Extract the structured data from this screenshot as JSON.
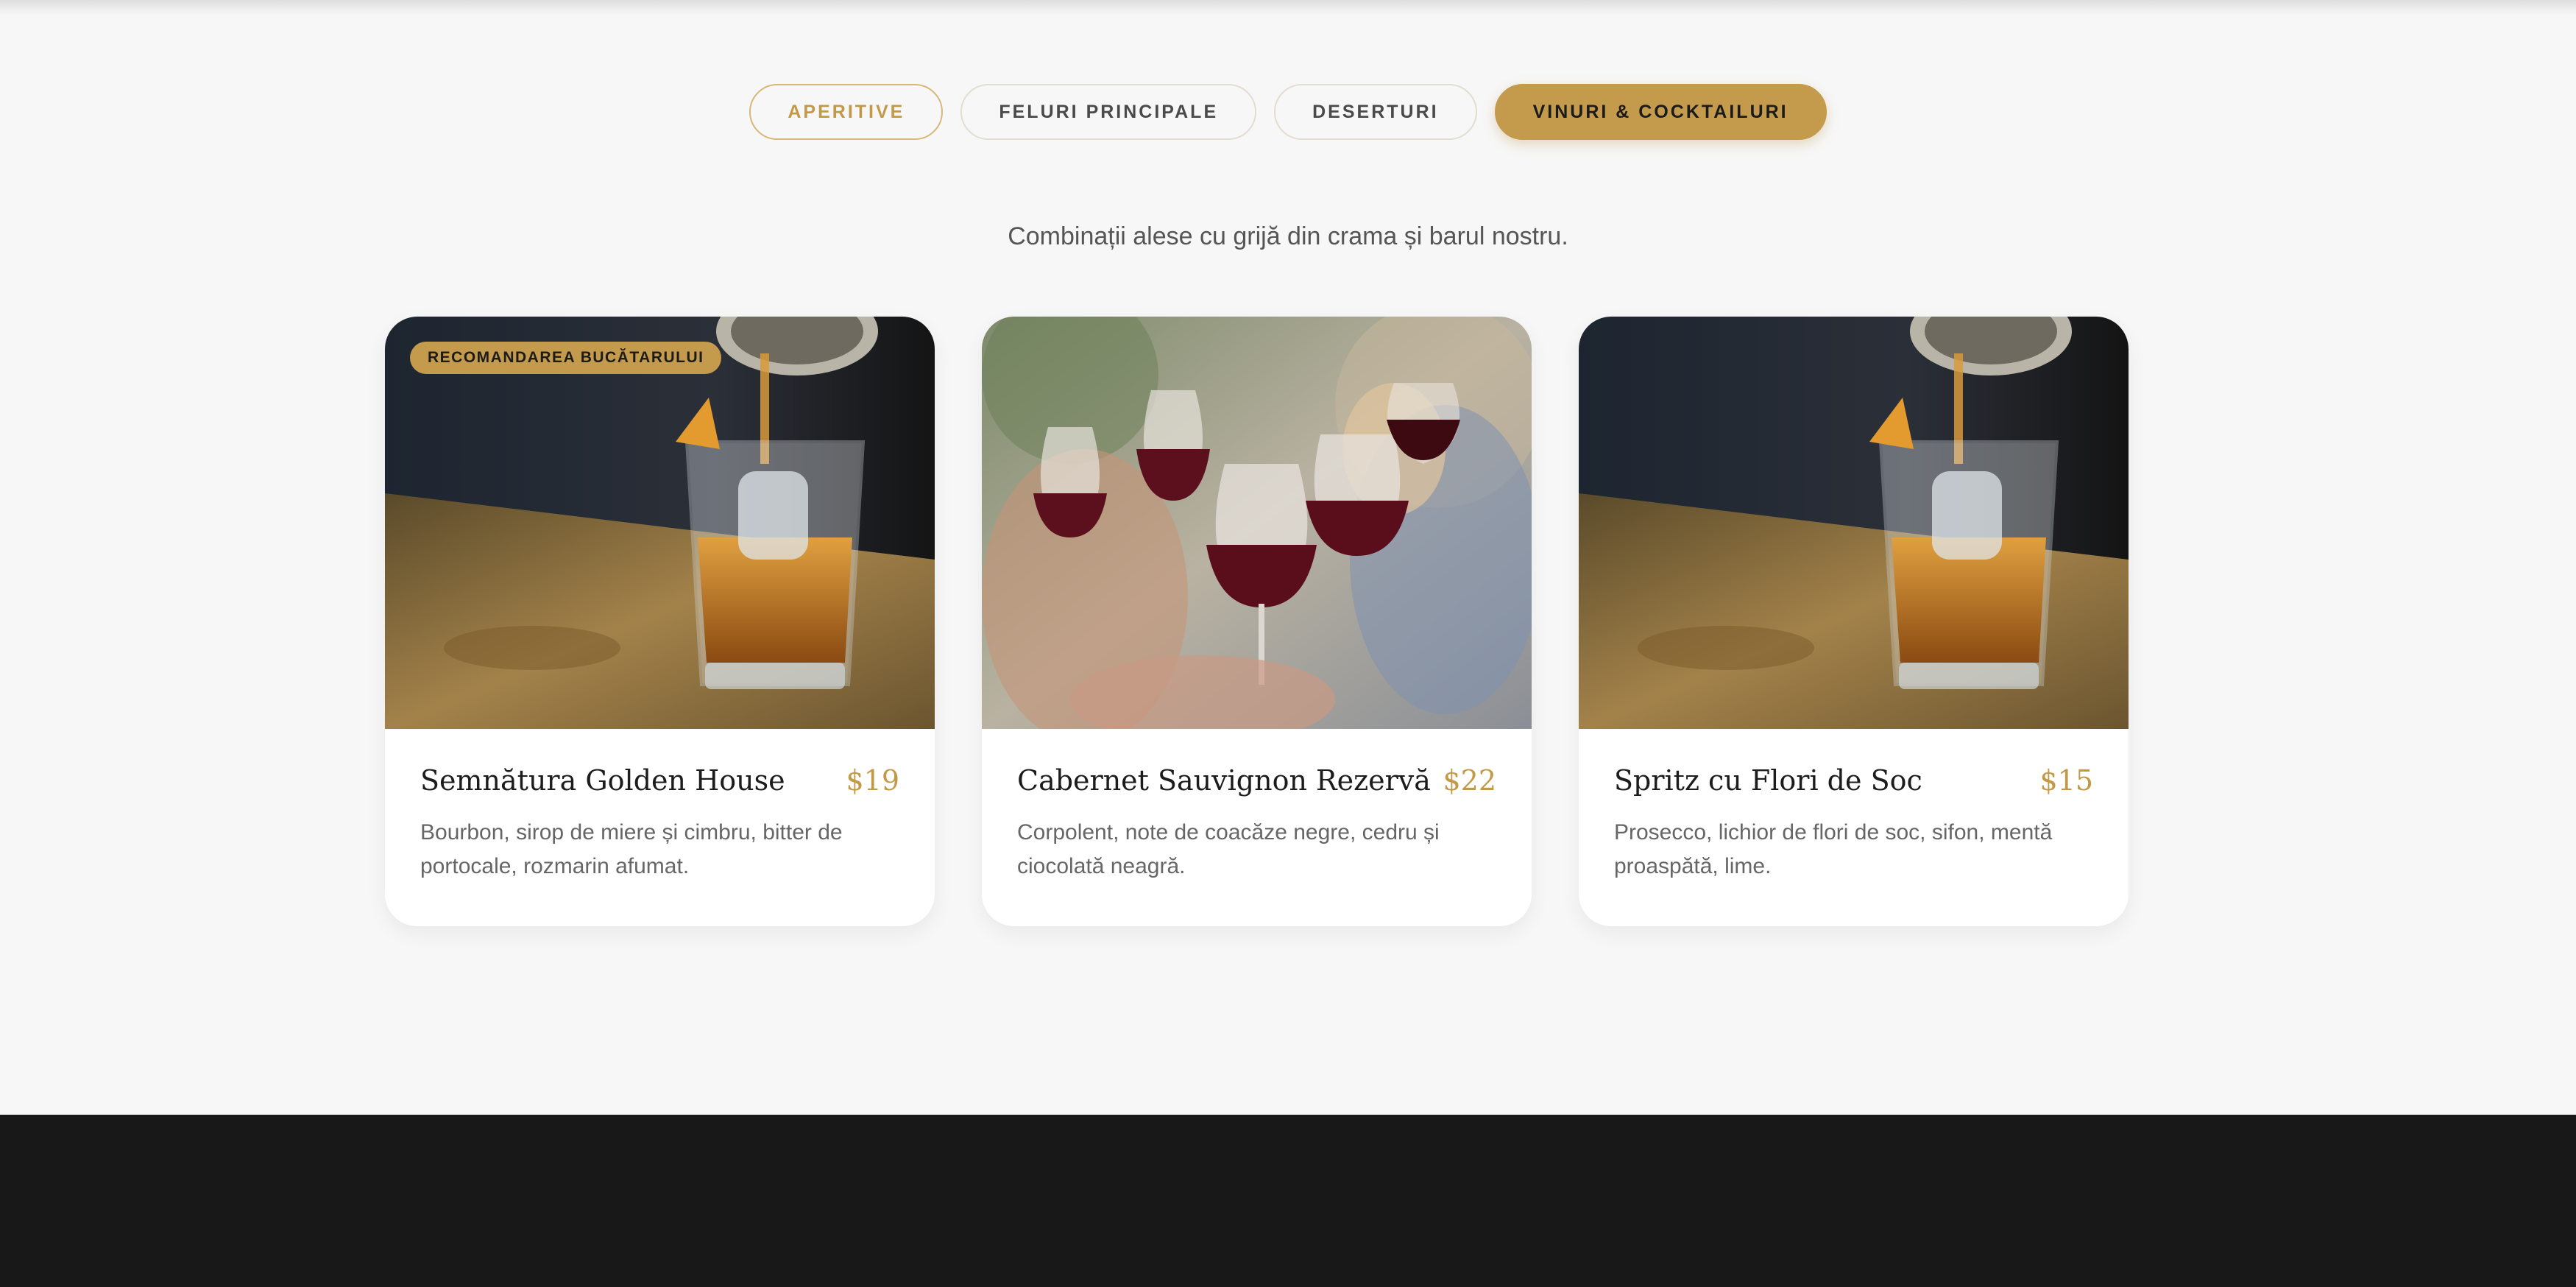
{
  "tabs": [
    {
      "label": "APERITIVE",
      "active": false
    },
    {
      "label": "FELURI PRINCIPALE",
      "active": false
    },
    {
      "label": "DESERTURI",
      "active": false
    },
    {
      "label": "VINURI & COCKTAILURI",
      "active": true
    }
  ],
  "subtitle": "Combinații alese cu grijă din crama și barul nostru.",
  "cards": [
    {
      "badge": "RECOMANDAREA BUCĂTARULUI",
      "title": "Semnătura Golden House",
      "price": "$19",
      "description": "Bourbon, sirop de miere și cimbru, bitter de portocale, rozmarin afumat.",
      "image": "whiskey-cocktail-photo"
    },
    {
      "title": "Cabernet Sauvignon Rezervă",
      "price": "$22",
      "description": "Corpolent, note de coacăze negre, cedru și ciocolată neagră.",
      "image": "red-wine-toast-photo"
    },
    {
      "title": "Spritz cu Flori de Soc",
      "price": "$15",
      "description": "Prosecco, lichior de flori de soc, sifon, mentă proaspătă, lime.",
      "image": "whiskey-cocktail-photo"
    }
  ],
  "colors": {
    "accent": "#c49a4c",
    "background": "#f7f7f7",
    "footer": "#181818"
  }
}
